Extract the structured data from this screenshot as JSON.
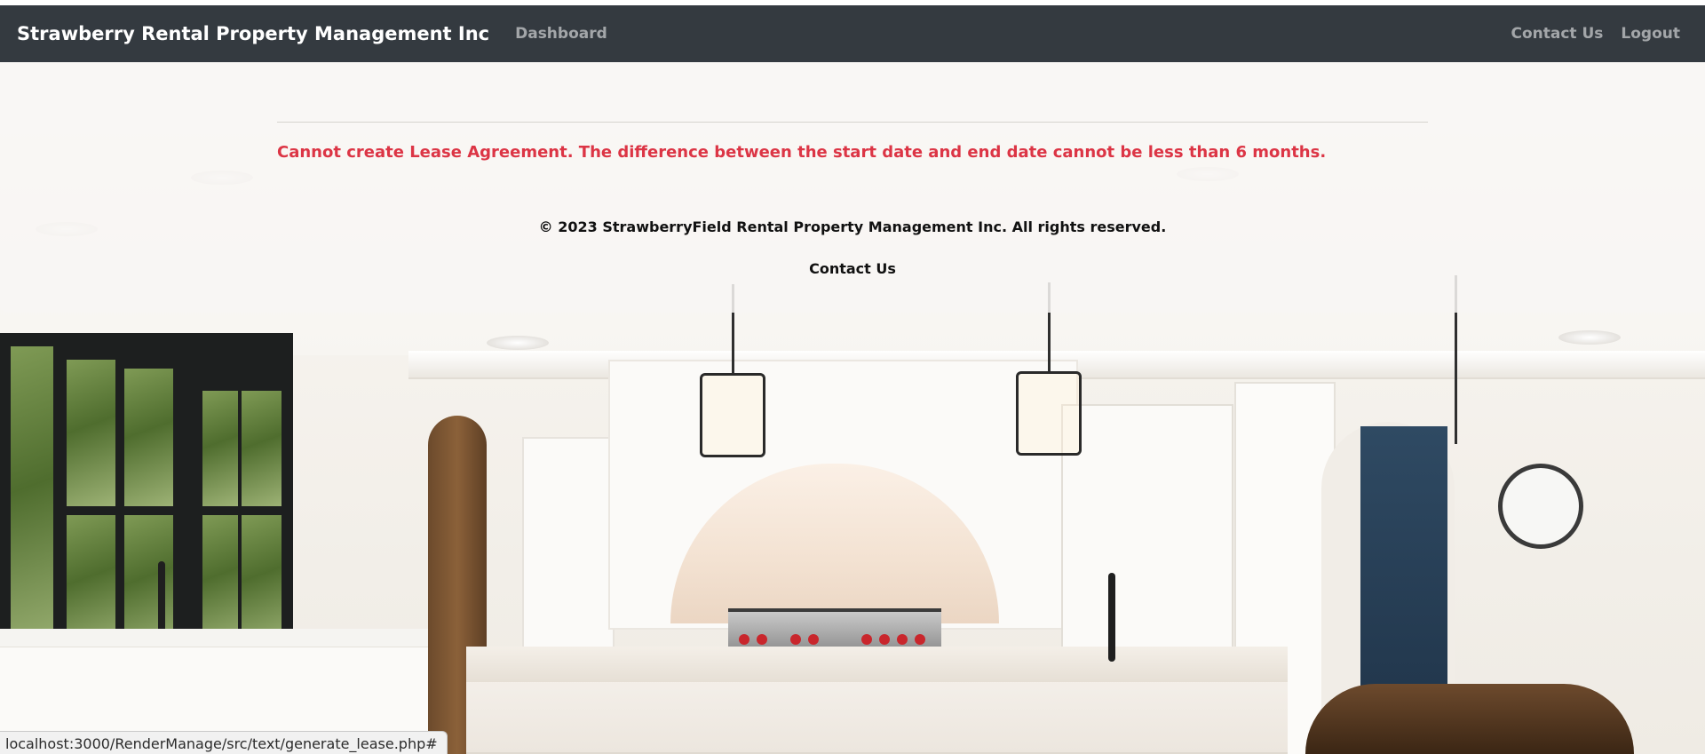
{
  "navbar": {
    "brand": "Strawberry Rental Property Management Inc",
    "dashboard_label": "Dashboard",
    "contact_label": "Contact Us",
    "logout_label": "Logout"
  },
  "main": {
    "error_message": "Cannot create Lease Agreement. The difference between the start date and end date cannot be less than 6 months."
  },
  "footer": {
    "copyright": "© 2023 StrawberryField Rental Property Management Inc. All rights reserved.",
    "contact_label": "Contact Us"
  },
  "statusbar": {
    "url": "localhost:3000/RenderManage/src/text/generate_lease.php#"
  },
  "colors": {
    "navbar_bg": "#343a40",
    "error_text": "#dc3545"
  }
}
